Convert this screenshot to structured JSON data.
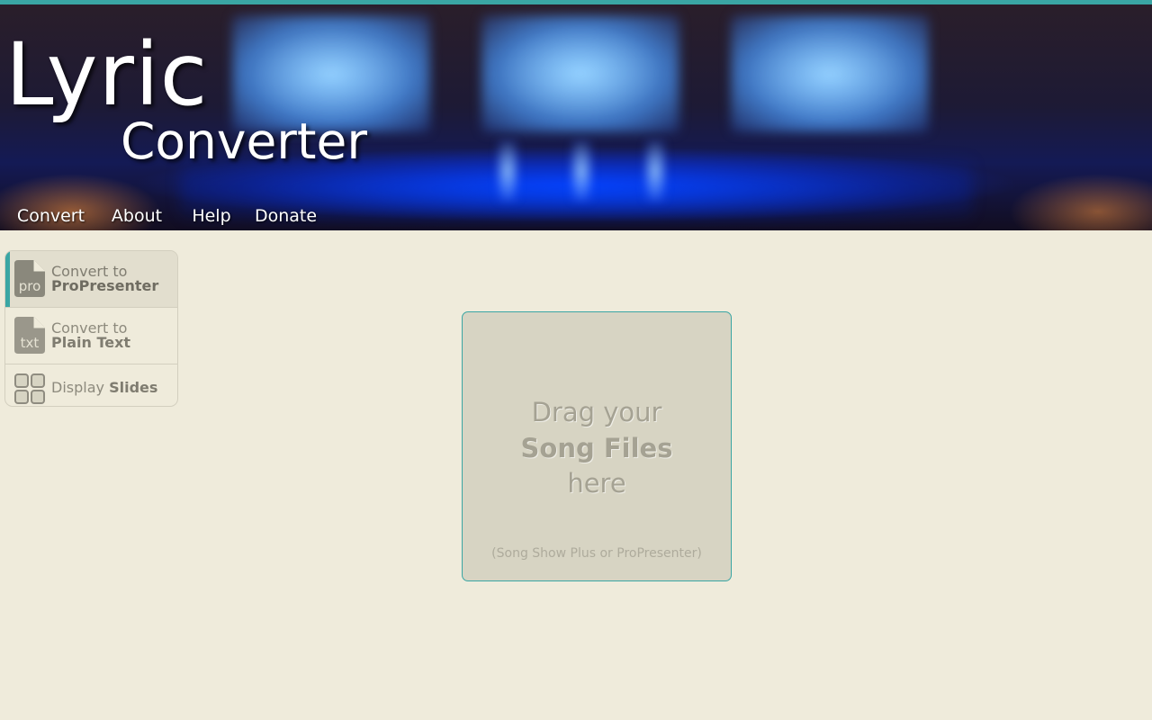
{
  "brand": {
    "title_line1": "Lyric",
    "title_line2": "Converter"
  },
  "nav": {
    "items": [
      {
        "label": "Convert",
        "active": true
      },
      {
        "label": "About",
        "active": false
      },
      {
        "label": "Help",
        "active": false
      },
      {
        "label": "Donate",
        "active": false
      }
    ]
  },
  "sidebar": {
    "items": [
      {
        "icon": "file-pro-icon",
        "icon_text": "pro",
        "line1": "Convert to",
        "line2": "ProPresenter",
        "active": true
      },
      {
        "icon": "file-txt-icon",
        "icon_text": "txt",
        "line1": "Convert to",
        "line2": "Plain Text",
        "active": false
      },
      {
        "icon": "grid-icon",
        "prefix": "Display",
        "strong": "Slides",
        "active": false
      }
    ]
  },
  "dropzone": {
    "line1": "Drag your",
    "line2": "Song Files",
    "line3": "here",
    "note": "(Song Show Plus or ProPresenter)"
  },
  "colors": {
    "accent": "#3aa6a4",
    "background": "#efebdb",
    "dropzone_bg": "#d7d4c3"
  }
}
